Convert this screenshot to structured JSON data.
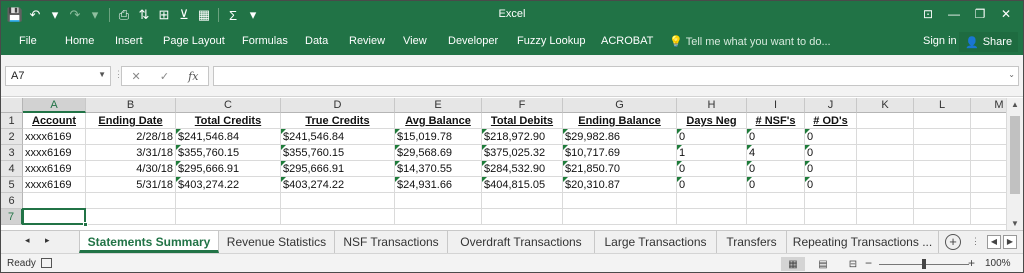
{
  "app": {
    "title": "Excel",
    "colors": {
      "accent": "#217346",
      "tri": "#1e7c3a"
    },
    "qat": [
      {
        "name": "save-icon",
        "glyph": "💾"
      },
      {
        "name": "undo-icon",
        "glyph": "↶"
      },
      {
        "name": "undo-dropdown-icon",
        "glyph": "▾"
      },
      {
        "name": "redo-icon",
        "glyph": "↷"
      },
      {
        "name": "redo-dropdown-icon",
        "glyph": "▾"
      },
      {
        "name": "print-preview-icon",
        "glyph": "⎙"
      },
      {
        "name": "sort-ascending-icon",
        "glyph": "⇅"
      },
      {
        "name": "freeze-panes-icon",
        "glyph": "⊞"
      },
      {
        "name": "filter-icon",
        "glyph": "⊻"
      },
      {
        "name": "border-icon",
        "glyph": "▦"
      },
      {
        "name": "autosum-icon",
        "glyph": "Σ"
      },
      {
        "name": "customize-qat-icon",
        "glyph": "▾"
      }
    ],
    "window_controls": [
      {
        "name": "ribbon-display-options-icon",
        "glyph": "⊡"
      },
      {
        "name": "minimize-icon",
        "glyph": "—"
      },
      {
        "name": "restore-icon",
        "glyph": "❐"
      },
      {
        "name": "close-icon",
        "glyph": "✕"
      }
    ]
  },
  "ribbon": {
    "tabs": [
      "File",
      "Home",
      "Insert",
      "Page Layout",
      "Formulas",
      "Data",
      "Review",
      "View",
      "Developer",
      "Fuzzy Lookup",
      "ACROBAT"
    ],
    "tellme": "Tell me what you want to do...",
    "signin": "Sign in",
    "share": "Share"
  },
  "formula_bar": {
    "name_box": "A7",
    "cancel_glyph": "✕",
    "enter_glyph": "✓",
    "fx_label": "fx",
    "formula": ""
  },
  "sheet": {
    "columns": [
      "A",
      "B",
      "C",
      "D",
      "E",
      "F",
      "G",
      "H",
      "I",
      "J",
      "K",
      "L",
      "M"
    ],
    "rows": [
      "1",
      "2",
      "3",
      "4",
      "5",
      "6",
      "7"
    ],
    "selected_column": "A",
    "selected_row": "7",
    "headers": [
      "Account",
      "Ending Date",
      "Total Credits",
      "True Credits",
      "Avg Balance",
      "Total Debits",
      "Ending Balance",
      "Days Neg",
      "# NSF's",
      "# OD's"
    ],
    "data": [
      [
        "xxxx6169",
        "2/28/18",
        "$241,546.84",
        "$241,546.84",
        "$15,019.78",
        "$218,972.90",
        "$29,982.86",
        "0",
        "0",
        "0"
      ],
      [
        "xxxx6169",
        "3/31/18",
        "$355,760.15",
        "$355,760.15",
        "$29,568.69",
        "$375,025.32",
        "$10,717.69",
        "1",
        "4",
        "0"
      ],
      [
        "xxxx6169",
        "4/30/18",
        "$295,666.91",
        "$295,666.91",
        "$14,370.55",
        "$284,532.90",
        "$21,850.70",
        "0",
        "0",
        "0"
      ],
      [
        "xxxx6169",
        "5/31/18",
        "$403,274.22",
        "$403,274.22",
        "$24,931.66",
        "$404,815.05",
        "$20,310.87",
        "0",
        "0",
        "0"
      ]
    ]
  },
  "sheet_tabs": {
    "tabs": [
      "Statements Summary",
      "Revenue Statistics",
      "NSF Transactions",
      "Overdraft Transactions",
      "Large Transactions",
      "Transfers",
      "Repeating Transactions ..."
    ],
    "active_index": 0,
    "nav_prev": "◂",
    "nav_next": "▸",
    "add_glyph": "+"
  },
  "status": {
    "ready": "Ready",
    "zoom": "100%",
    "zoom_fraction": 0.5,
    "zoom_minus": "−",
    "zoom_plus": "+"
  }
}
